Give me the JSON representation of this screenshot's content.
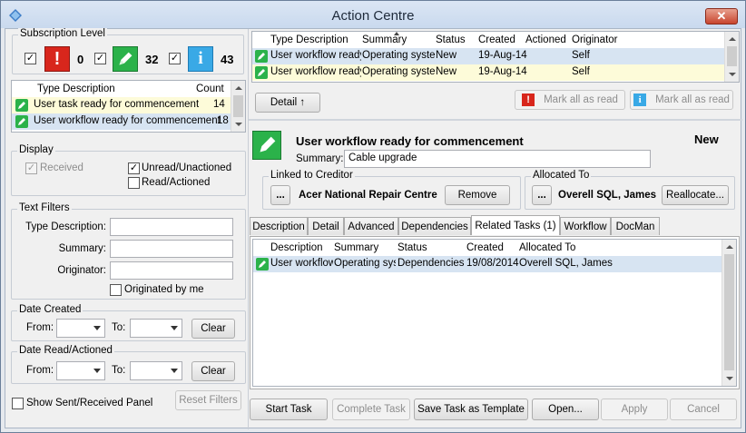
{
  "window": {
    "title": "Action Centre",
    "close_glyph": "✕"
  },
  "subscription": {
    "title": "Subscription Level",
    "levels": [
      {
        "name": "urgent",
        "count": "0",
        "color": "#d8261c",
        "glyph": "!"
      },
      {
        "name": "workflow",
        "count": "32",
        "color": "#2bb24a"
      },
      {
        "name": "info",
        "count": "43",
        "color": "#39a9e6",
        "glyph": "i"
      }
    ]
  },
  "type_summary": {
    "columns": [
      "Type Description",
      "Count"
    ],
    "rows": [
      {
        "description": "User task ready for commencement",
        "count": "14"
      },
      {
        "description": "User workflow ready for commencement",
        "count": "18"
      }
    ]
  },
  "display": {
    "title": "Display",
    "received": "Received",
    "unread": "Unread/Unactioned",
    "read": "Read/Actioned",
    "check": "✓"
  },
  "text_filters": {
    "title": "Text Filters",
    "type_description": "Type Description:",
    "summary": "Summary:",
    "originator": "Originator:",
    "originated_by_me": "Originated by me"
  },
  "date_created": {
    "title": "Date Created",
    "from": "From:",
    "to": "To:",
    "clear": "Clear"
  },
  "date_read": {
    "title": "Date Read/Actioned",
    "from": "From:",
    "to": "To:",
    "clear": "Clear"
  },
  "footer_left": {
    "show_panel": "Show Sent/Received Panel",
    "reset": "Reset Filters"
  },
  "messages": {
    "columns": [
      "Type Description",
      "Summary",
      "Status",
      "Created",
      "Actioned",
      "Originator"
    ],
    "rows": [
      {
        "type": "User workflow ready",
        "summary": "Operating system",
        "status": "New",
        "created": "19-Aug-14",
        "actioned": "",
        "originator": "Self"
      },
      {
        "type": "User workflow ready",
        "summary": "Operating system",
        "status": "New",
        "created": "19-Aug-14",
        "actioned": "",
        "originator": "Self"
      }
    ]
  },
  "toolbar": {
    "detail": "Detail ↑",
    "mark_urgent": "Mark all as read",
    "mark_info": "Mark all as read"
  },
  "detail": {
    "title": "User workflow ready for commencement",
    "status": "New",
    "summary_label": "Summary:",
    "summary_value": "Cable upgrade",
    "linked_title": "Linked to Creditor",
    "ellipsis": "...",
    "creditor": "Acer National Repair Centre",
    "remove": "Remove",
    "allocated_title": "Allocated To",
    "allocated": "Overell SQL, James",
    "reallocate": "Reallocate..."
  },
  "tabs": [
    "Description",
    "Detail",
    "Advanced",
    "Dependencies",
    "Related Tasks (1)",
    "Workflow",
    "DocMan"
  ],
  "related_tasks": {
    "columns": [
      "Description",
      "Summary",
      "Status",
      "Created",
      "Allocated To"
    ],
    "rows": [
      {
        "description": "User workflow",
        "summary": "Operating system",
        "status": "Dependencies",
        "created": "19/08/2014",
        "allocated": "Overell SQL, James"
      }
    ]
  },
  "actions": {
    "start": "Start Task",
    "complete": "Complete Task",
    "save_template": "Save Task as Template",
    "open": "Open...",
    "apply": "Apply",
    "cancel": "Cancel"
  }
}
